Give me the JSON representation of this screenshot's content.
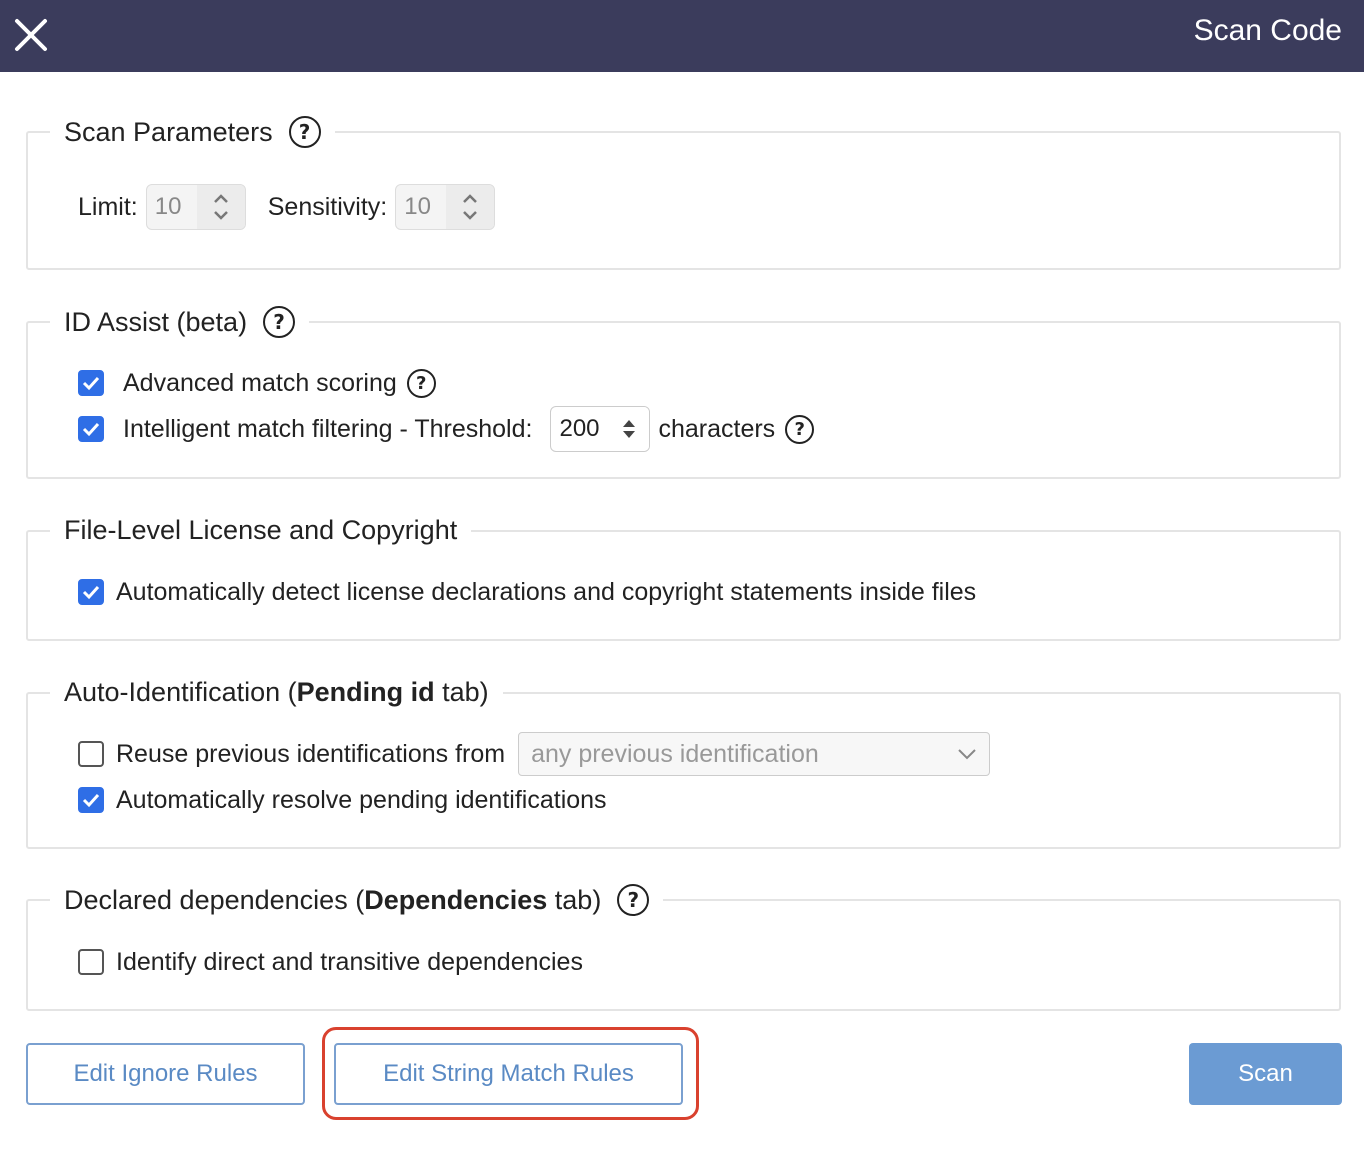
{
  "header": {
    "title": "Scan Code",
    "close_icon": "close-icon"
  },
  "scan_parameters": {
    "legend": "Scan Parameters",
    "limit_label": "Limit:",
    "limit_value": "10",
    "sensitivity_label": "Sensitivity:",
    "sensitivity_value": "10"
  },
  "id_assist": {
    "legend": "ID Assist (beta)",
    "advanced_label": "Advanced match scoring",
    "advanced_checked": true,
    "intelligent_label": "Intelligent match filtering - Threshold:",
    "intelligent_checked": true,
    "threshold_value": "200",
    "threshold_unit": "characters"
  },
  "file_level": {
    "legend": "File-Level License and Copyright",
    "detect_label": "Automatically detect license declarations and copyright statements inside files",
    "detect_checked": true
  },
  "auto_identification": {
    "legend_prefix": "Auto-Identification (",
    "legend_bold": "Pending id",
    "legend_suffix": " tab)",
    "reuse_label": "Reuse previous identifications from",
    "reuse_checked": false,
    "reuse_select_value": "any previous identification",
    "resolve_label": "Automatically resolve pending identifications",
    "resolve_checked": true
  },
  "declared_dependencies": {
    "legend_prefix": "Declared dependencies (",
    "legend_bold": "Dependencies",
    "legend_suffix": " tab)",
    "identify_label": "Identify direct and transitive dependencies",
    "identify_checked": false
  },
  "buttons": {
    "edit_ignore": "Edit Ignore Rules",
    "edit_string_match": "Edit String Match Rules",
    "scan": "Scan"
  },
  "colors": {
    "header_bg": "#3b3c5c",
    "checkbox_checked": "#2f6ee6",
    "button_outline": "#7aa0d0",
    "button_primary": "#6b9bd3",
    "highlight": "#d9412e"
  }
}
